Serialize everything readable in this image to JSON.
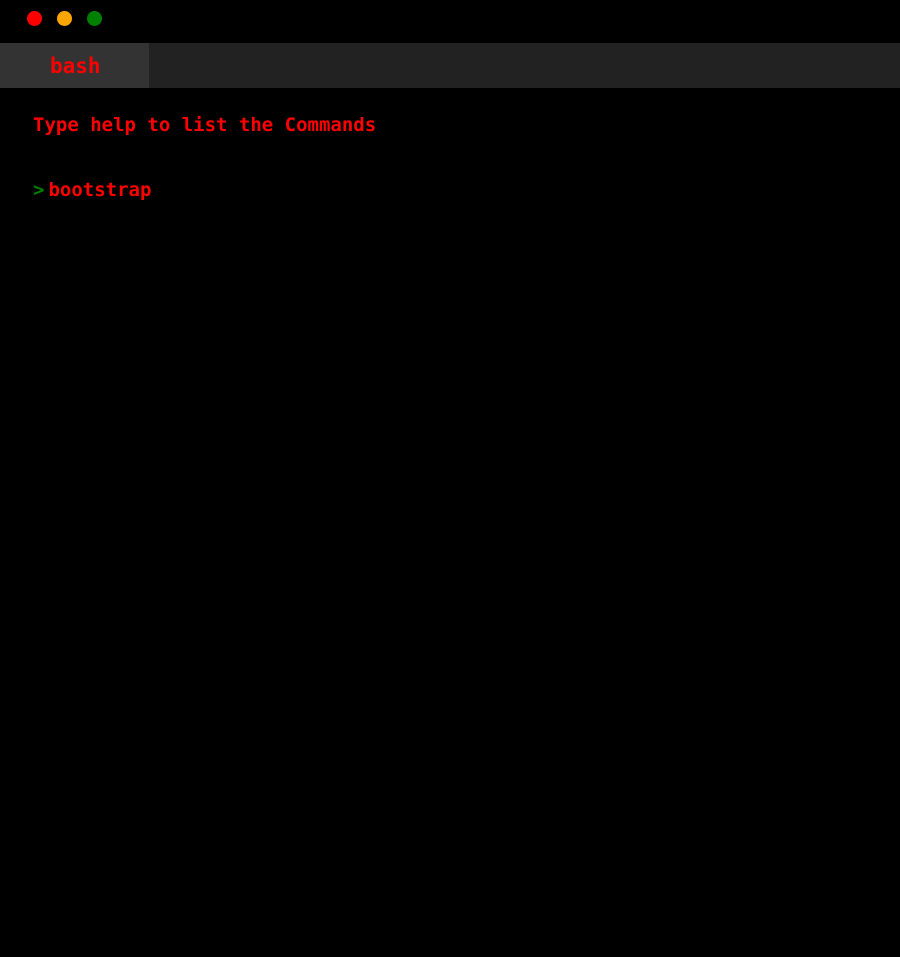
{
  "window": {
    "buttons": [
      {
        "name": "close",
        "color": "#ff0000"
      },
      {
        "name": "minimize",
        "color": "#ffa500"
      },
      {
        "name": "maximize",
        "color": "#008000"
      }
    ]
  },
  "tabs": [
    {
      "label": "bash",
      "active": true
    }
  ],
  "console": {
    "welcome_text": "Type help to list the Commands",
    "prompt_symbol": ">",
    "current_input": "bootstrap"
  },
  "colors": {
    "background": "#000000",
    "tabbar": "#222222",
    "active_tab": "#333333",
    "text": "#ff0000",
    "prompt": "#008000"
  }
}
